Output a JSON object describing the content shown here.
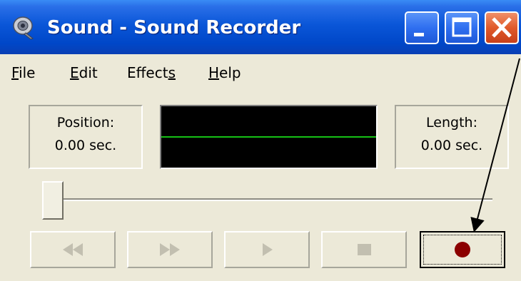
{
  "window": {
    "title": "Sound - Sound Recorder",
    "app_icon": "speaker-icon"
  },
  "titlebar_buttons": [
    {
      "name": "minimize",
      "icon": "minimize-icon"
    },
    {
      "name": "maximize",
      "icon": "maximize-icon"
    },
    {
      "name": "close",
      "icon": "close-icon"
    }
  ],
  "menu": {
    "file": {
      "underlined": "F",
      "rest": "ile"
    },
    "edit": {
      "underlined": "E",
      "rest": "dit"
    },
    "effects": {
      "before": "Effect",
      "underlined": "s"
    },
    "help": {
      "underlined": "H",
      "rest": "elp"
    }
  },
  "position": {
    "label": "Position:",
    "value": "0.00 sec."
  },
  "length": {
    "label": "Length:",
    "value": "0.00 sec."
  },
  "waveform": {
    "background": "#000000",
    "line_color": "#16c116"
  },
  "seek": {
    "fraction": 0.0
  },
  "controls": [
    {
      "name": "seek-to-start",
      "icon": "rewind-icon",
      "enabled": false
    },
    {
      "name": "seek-to-end",
      "icon": "fast-forward-icon",
      "enabled": false
    },
    {
      "name": "play",
      "icon": "play-icon",
      "enabled": false
    },
    {
      "name": "stop",
      "icon": "stop-icon",
      "enabled": false
    },
    {
      "name": "record",
      "icon": "record-icon",
      "enabled": true,
      "focused": true,
      "color": "#8b0000"
    }
  ],
  "annotation": {
    "type": "arrow",
    "target": "record-button",
    "color": "#000000"
  },
  "colors": {
    "titlebar": "#0a56d8",
    "window_face": "#ece9d8",
    "close_button": "#e05a2a",
    "disabled_glyph": "#c2bfb0"
  }
}
